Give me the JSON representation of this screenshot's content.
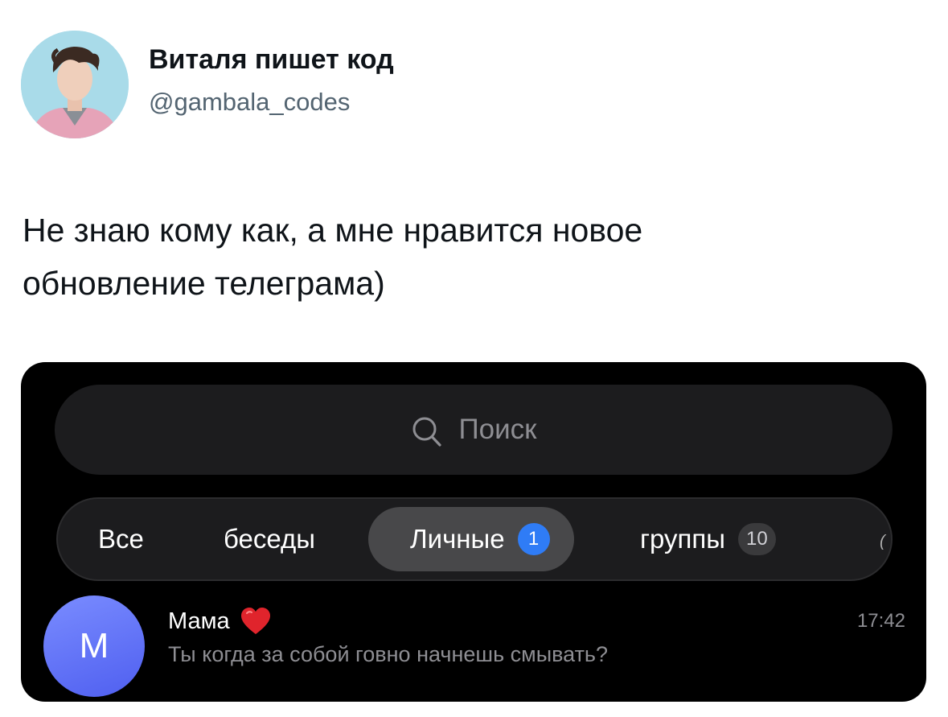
{
  "tweet": {
    "display_name": "Виталя пишет код",
    "handle": "@gambala_codes",
    "text_lines": [
      "Не знаю кому как, а мне нравится новое",
      "обновление телеграма)"
    ]
  },
  "telegram": {
    "search": {
      "icon": "search-icon",
      "placeholder": "Поиск"
    },
    "tabs": [
      {
        "label": "Все",
        "active": false
      },
      {
        "label": "беседы",
        "active": false
      },
      {
        "label": "Личные",
        "active": true,
        "badge": "1"
      },
      {
        "label": "группы",
        "active": false,
        "badge": "10"
      }
    ],
    "chats": [
      {
        "avatar_letter": "M",
        "name": "Мама",
        "emoji_icon": "heart-icon",
        "time": "17:42",
        "preview": "Ты когда за собой говно начнешь смывать?"
      }
    ]
  },
  "colors": {
    "accent_blue": "#2f7cf6",
    "dark_bg": "#000000",
    "panel_bg": "#1c1c1e",
    "heart_red": "#e0242c"
  }
}
